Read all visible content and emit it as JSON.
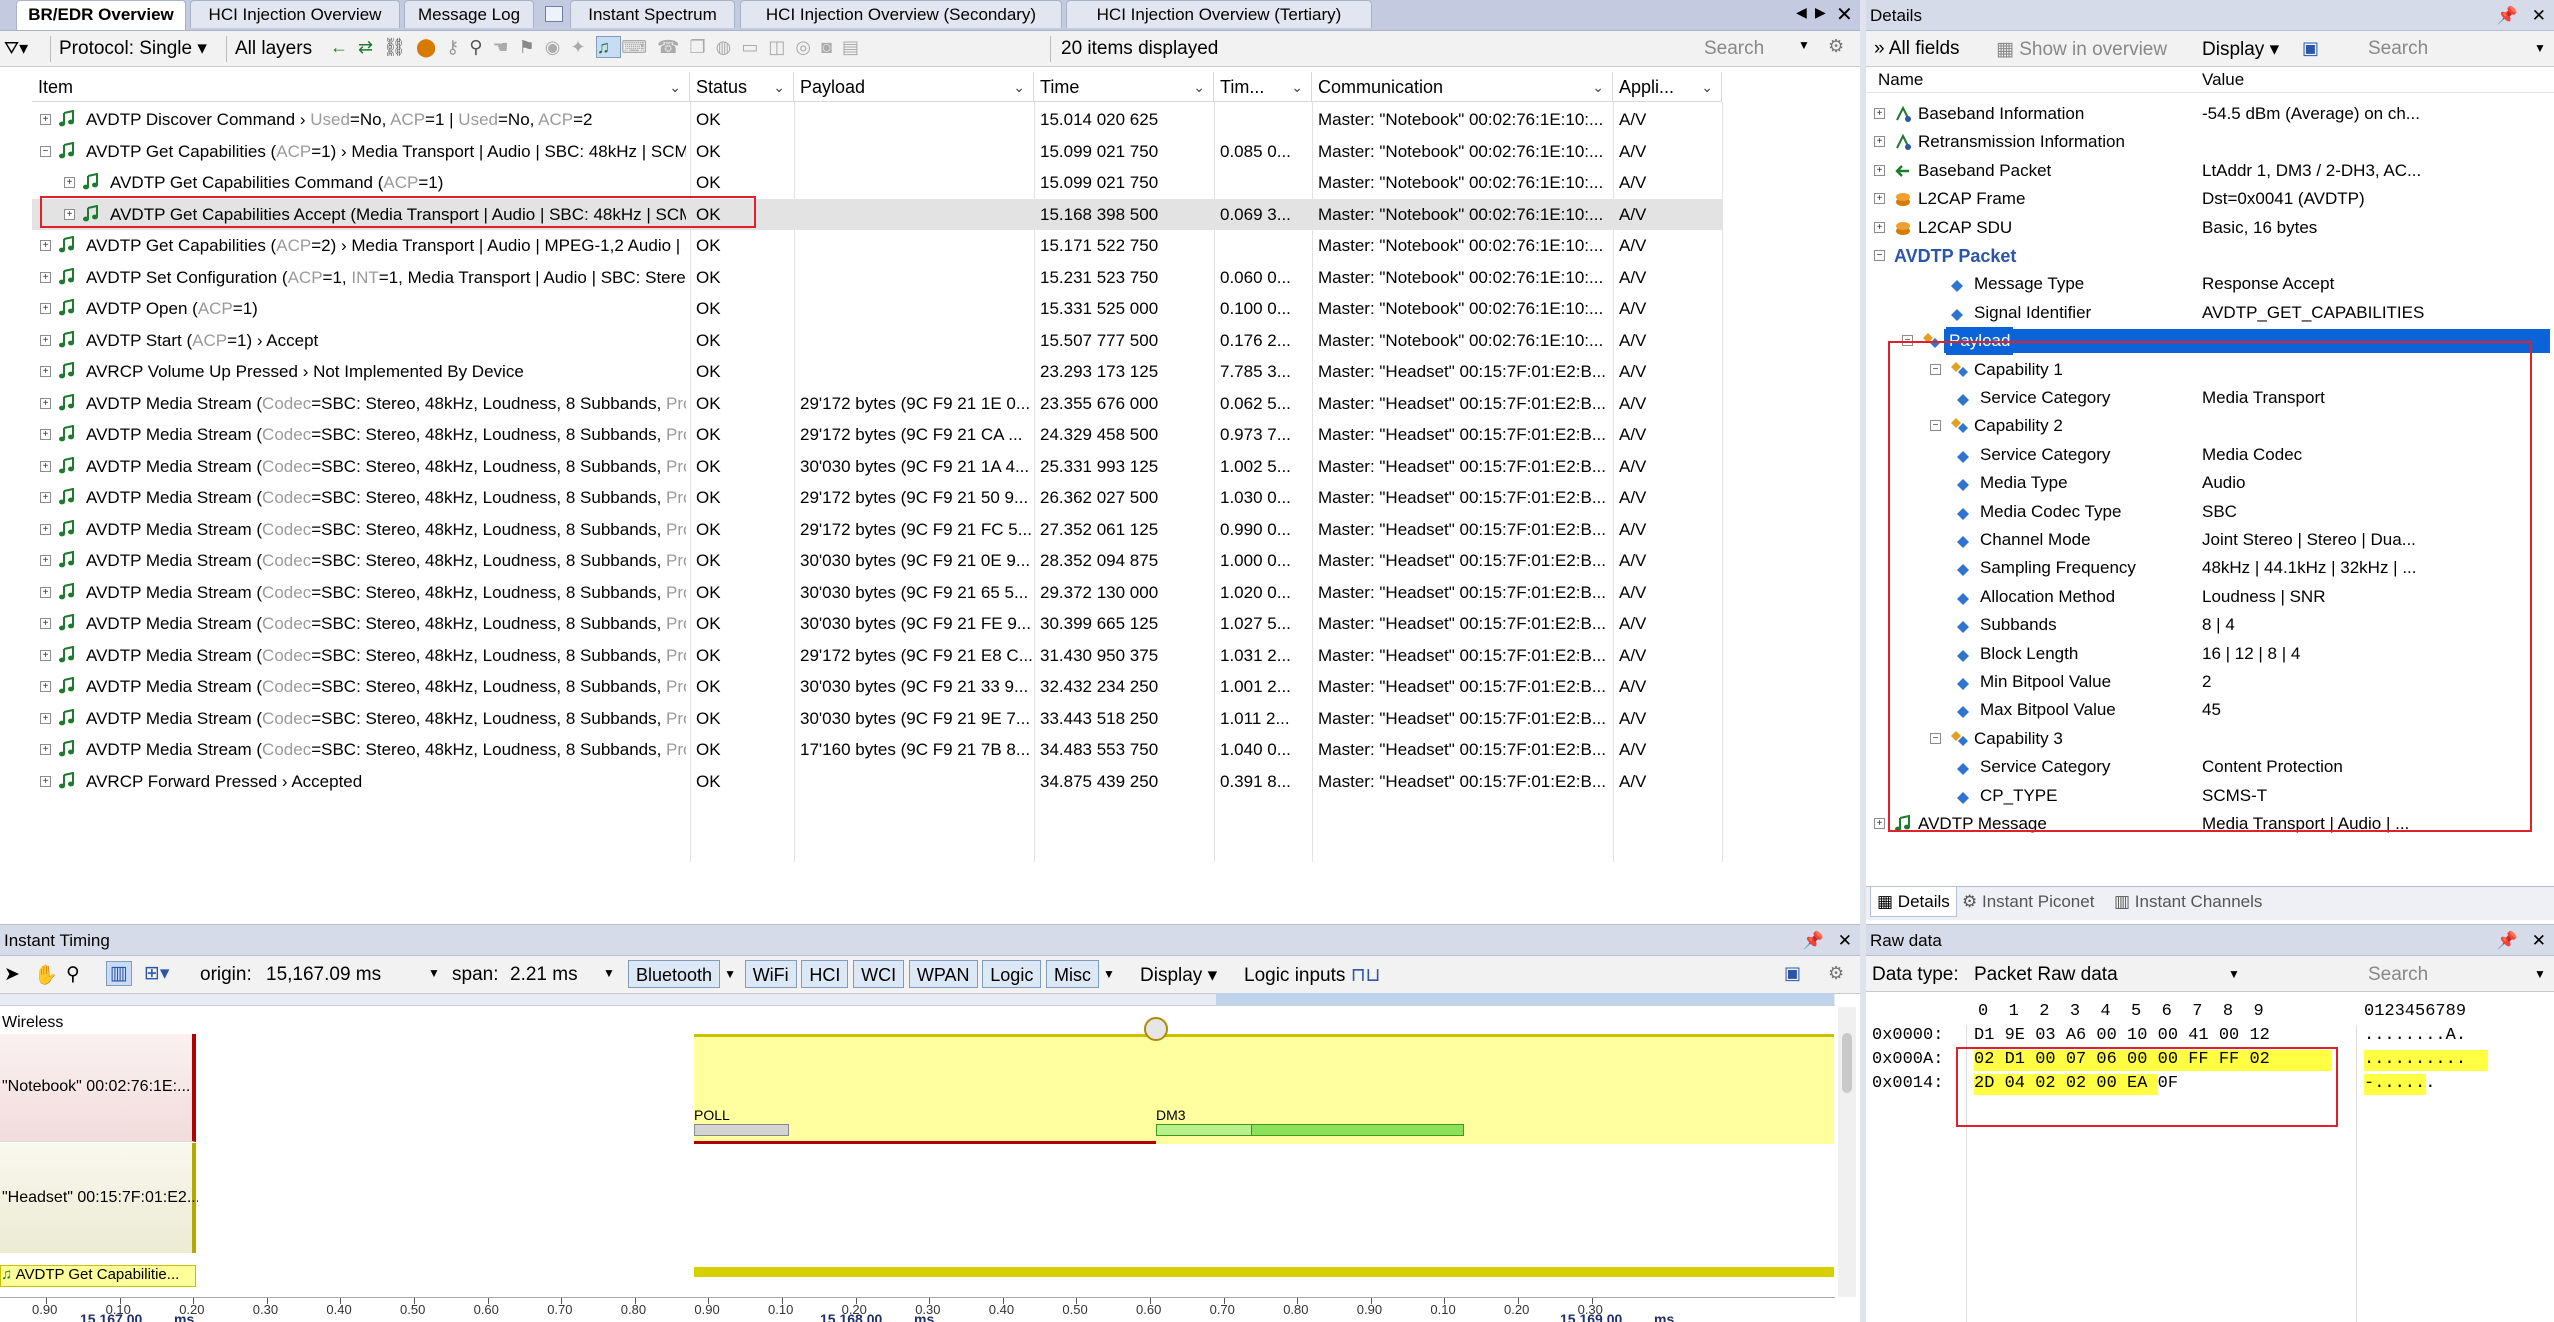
{
  "tabs": [
    {
      "label": "BR/EDR Overview",
      "active": true
    },
    {
      "label": "HCI Injection Overview",
      "active": false
    },
    {
      "label": "Message Log",
      "active": false
    },
    {
      "label": "Instant Spectrum",
      "active": false
    },
    {
      "label": "HCI Injection Overview (Secondary)",
      "active": false
    },
    {
      "label": "HCI Injection Overview (Tertiary)",
      "active": false
    }
  ],
  "toolbar": {
    "protocol": "Protocol: Single",
    "layers": "All layers",
    "count": "20 items displayed",
    "search_placeholder": "Search"
  },
  "columns": [
    "Item",
    "Status",
    "Payload",
    "Time",
    "Tim...",
    "Communication",
    "Appli..."
  ],
  "rows": [
    {
      "indent": 0,
      "exp": "+",
      "item": [
        [
          "AVDTP Discover Command › ",
          ""
        ],
        [
          "Used",
          "g"
        ],
        [
          "=No, ",
          ""
        ],
        [
          "ACP",
          "g"
        ],
        [
          "=1 | ",
          ""
        ],
        [
          "Used",
          "g"
        ],
        [
          "=No, ",
          ""
        ],
        [
          "ACP",
          "g"
        ],
        [
          "=2",
          ""
        ]
      ],
      "status": "OK",
      "payload": "",
      "time": "15.014 020 625",
      "tim": "",
      "comm": "Master: \"Notebook\" 00:02:76:1E:10:...",
      "app": "A/V"
    },
    {
      "indent": 0,
      "exp": "−",
      "item": [
        [
          "AVDTP Get Capabilities (",
          ""
        ],
        [
          "ACP",
          "g"
        ],
        [
          "=1) › Media Transport | Audio | SBC: 48kHz | SCMS-T",
          ""
        ]
      ],
      "status": "OK",
      "payload": "",
      "time": "15.099 021 750",
      "tim": "0.085 0...",
      "comm": "Master: \"Notebook\" 00:02:76:1E:10:...",
      "app": "A/V"
    },
    {
      "indent": 1,
      "exp": "+",
      "item": [
        [
          "AVDTP Get Capabilities Command (",
          ""
        ],
        [
          "ACP",
          "g"
        ],
        [
          "=1)",
          ""
        ]
      ],
      "status": "OK",
      "payload": "",
      "time": "15.099 021 750",
      "tim": "",
      "comm": "Master: \"Notebook\" 00:02:76:1E:10:...",
      "app": "A/V"
    },
    {
      "indent": 1,
      "exp": "+",
      "item": [
        [
          "AVDTP Get Capabilities Accept (Media Transport | Audio | SBC: 48kHz | SCM...",
          ""
        ]
      ],
      "status": "OK",
      "payload": "",
      "time": "15.168 398 500",
      "tim": "0.069 3...",
      "comm": "Master: \"Notebook\" 00:02:76:1E:10:...",
      "app": "A/V",
      "selected": true
    },
    {
      "indent": 0,
      "exp": "+",
      "item": [
        [
          "AVDTP Get Capabilities (",
          ""
        ],
        [
          "ACP",
          "g"
        ],
        [
          "=2) › Media Transport | Audio | MPEG-1,2 Audio | S...",
          ""
        ]
      ],
      "status": "OK",
      "payload": "",
      "time": "15.171 522 750",
      "tim": "",
      "comm": "Master: \"Notebook\" 00:02:76:1E:10:...",
      "app": "A/V"
    },
    {
      "indent": 0,
      "exp": "+",
      "item": [
        [
          "AVDTP Set Configuration (",
          ""
        ],
        [
          "ACP",
          "g"
        ],
        [
          "=1, ",
          ""
        ],
        [
          "INT",
          "g"
        ],
        [
          "=1, Media Transport | Audio | SBC: Stere...",
          ""
        ]
      ],
      "status": "OK",
      "payload": "",
      "time": "15.231 523 750",
      "tim": "0.060 0...",
      "comm": "Master: \"Notebook\" 00:02:76:1E:10:...",
      "app": "A/V"
    },
    {
      "indent": 0,
      "exp": "+",
      "item": [
        [
          "AVDTP Open (",
          ""
        ],
        [
          "ACP",
          "g"
        ],
        [
          "=1)",
          ""
        ]
      ],
      "status": "OK",
      "payload": "",
      "time": "15.331 525 000",
      "tim": "0.100 0...",
      "comm": "Master: \"Notebook\" 00:02:76:1E:10:...",
      "app": "A/V"
    },
    {
      "indent": 0,
      "exp": "+",
      "item": [
        [
          "AVDTP Start (",
          ""
        ],
        [
          "ACP",
          "g"
        ],
        [
          "=1) › Accept",
          ""
        ]
      ],
      "status": "OK",
      "payload": "",
      "time": "15.507 777 500",
      "tim": "0.176 2...",
      "comm": "Master: \"Notebook\" 00:02:76:1E:10:...",
      "app": "A/V"
    },
    {
      "indent": 0,
      "exp": "+",
      "item": [
        [
          "AVRCP Volume Up Pressed › Not Implemented By Device",
          ""
        ]
      ],
      "status": "OK",
      "payload": "",
      "time": "23.293 173 125",
      "tim": "7.785 3...",
      "comm": "Master: \"Headset\" 00:15:7F:01:E2:B...",
      "app": "A/V"
    },
    {
      "indent": 0,
      "exp": "+",
      "item": [
        [
          "AVDTP Media Stream (",
          ""
        ],
        [
          "Codec",
          "g"
        ],
        [
          "=SBC: Stereo, 48kHz, Loudness, 8 Subbands, ",
          ""
        ],
        [
          "Prot...",
          "g"
        ]
      ],
      "status": "OK",
      "payload": "29'172 bytes (9C F9 21 1E 0...",
      "time": "23.355 676 000",
      "tim": "0.062 5...",
      "comm": "Master: \"Headset\" 00:15:7F:01:E2:B...",
      "app": "A/V"
    },
    {
      "indent": 0,
      "exp": "+",
      "item": [
        [
          "AVDTP Media Stream (",
          ""
        ],
        [
          "Codec",
          "g"
        ],
        [
          "=SBC: Stereo, 48kHz, Loudness, 8 Subbands, ",
          ""
        ],
        [
          "Prot...",
          "g"
        ]
      ],
      "status": "OK",
      "payload": "29'172 bytes (9C F9 21 CA ...",
      "time": "24.329 458 500",
      "tim": "0.973 7...",
      "comm": "Master: \"Headset\" 00:15:7F:01:E2:B...",
      "app": "A/V"
    },
    {
      "indent": 0,
      "exp": "+",
      "item": [
        [
          "AVDTP Media Stream (",
          ""
        ],
        [
          "Codec",
          "g"
        ],
        [
          "=SBC: Stereo, 48kHz, Loudness, 8 Subbands, ",
          ""
        ],
        [
          "Prot...",
          "g"
        ]
      ],
      "status": "OK",
      "payload": "30'030 bytes (9C F9 21 1A 4...",
      "time": "25.331 993 125",
      "tim": "1.002 5...",
      "comm": "Master: \"Headset\" 00:15:7F:01:E2:B...",
      "app": "A/V"
    },
    {
      "indent": 0,
      "exp": "+",
      "item": [
        [
          "AVDTP Media Stream (",
          ""
        ],
        [
          "Codec",
          "g"
        ],
        [
          "=SBC: Stereo, 48kHz, Loudness, 8 Subbands, ",
          ""
        ],
        [
          "Prot...",
          "g"
        ]
      ],
      "status": "OK",
      "payload": "29'172 bytes (9C F9 21 50 9...",
      "time": "26.362 027 500",
      "tim": "1.030 0...",
      "comm": "Master: \"Headset\" 00:15:7F:01:E2:B...",
      "app": "A/V"
    },
    {
      "indent": 0,
      "exp": "+",
      "item": [
        [
          "AVDTP Media Stream (",
          ""
        ],
        [
          "Codec",
          "g"
        ],
        [
          "=SBC: Stereo, 48kHz, Loudness, 8 Subbands, ",
          ""
        ],
        [
          "Prot...",
          "g"
        ]
      ],
      "status": "OK",
      "payload": "29'172 bytes (9C F9 21 FC 5...",
      "time": "27.352 061 125",
      "tim": "0.990 0...",
      "comm": "Master: \"Headset\" 00:15:7F:01:E2:B...",
      "app": "A/V"
    },
    {
      "indent": 0,
      "exp": "+",
      "item": [
        [
          "AVDTP Media Stream (",
          ""
        ],
        [
          "Codec",
          "g"
        ],
        [
          "=SBC: Stereo, 48kHz, Loudness, 8 Subbands, ",
          ""
        ],
        [
          "Prot...",
          "g"
        ]
      ],
      "status": "OK",
      "payload": "30'030 bytes (9C F9 21 0E 9...",
      "time": "28.352 094 875",
      "tim": "1.000 0...",
      "comm": "Master: \"Headset\" 00:15:7F:01:E2:B...",
      "app": "A/V"
    },
    {
      "indent": 0,
      "exp": "+",
      "item": [
        [
          "AVDTP Media Stream (",
          ""
        ],
        [
          "Codec",
          "g"
        ],
        [
          "=SBC: Stereo, 48kHz, Loudness, 8 Subbands, ",
          ""
        ],
        [
          "Prot...",
          "g"
        ]
      ],
      "status": "OK",
      "payload": "30'030 bytes (9C F9 21 65 5...",
      "time": "29.372 130 000",
      "tim": "1.020 0...",
      "comm": "Master: \"Headset\" 00:15:7F:01:E2:B...",
      "app": "A/V"
    },
    {
      "indent": 0,
      "exp": "+",
      "item": [
        [
          "AVDTP Media Stream (",
          ""
        ],
        [
          "Codec",
          "g"
        ],
        [
          "=SBC: Stereo, 48kHz, Loudness, 8 Subbands, ",
          ""
        ],
        [
          "Prot...",
          "g"
        ]
      ],
      "status": "OK",
      "payload": "30'030 bytes (9C F9 21 FE 9...",
      "time": "30.399 665 125",
      "tim": "1.027 5...",
      "comm": "Master: \"Headset\" 00:15:7F:01:E2:B...",
      "app": "A/V"
    },
    {
      "indent": 0,
      "exp": "+",
      "item": [
        [
          "AVDTP Media Stream (",
          ""
        ],
        [
          "Codec",
          "g"
        ],
        [
          "=SBC: Stereo, 48kHz, Loudness, 8 Subbands, ",
          ""
        ],
        [
          "Prot...",
          "g"
        ]
      ],
      "status": "OK",
      "payload": "29'172 bytes (9C F9 21 E8 C...",
      "time": "31.430 950 375",
      "tim": "1.031 2...",
      "comm": "Master: \"Headset\" 00:15:7F:01:E2:B...",
      "app": "A/V"
    },
    {
      "indent": 0,
      "exp": "+",
      "item": [
        [
          "AVDTP Media Stream (",
          ""
        ],
        [
          "Codec",
          "g"
        ],
        [
          "=SBC: Stereo, 48kHz, Loudness, 8 Subbands, ",
          ""
        ],
        [
          "Prot...",
          "g"
        ]
      ],
      "status": "OK",
      "payload": "30'030 bytes (9C F9 21 33 9...",
      "time": "32.432 234 250",
      "tim": "1.001 2...",
      "comm": "Master: \"Headset\" 00:15:7F:01:E2:B...",
      "app": "A/V"
    },
    {
      "indent": 0,
      "exp": "+",
      "item": [
        [
          "AVDTP Media Stream (",
          ""
        ],
        [
          "Codec",
          "g"
        ],
        [
          "=SBC: Stereo, 48kHz, Loudness, 8 Subbands, ",
          ""
        ],
        [
          "Prot...",
          "g"
        ]
      ],
      "status": "OK",
      "payload": "30'030 bytes (9C F9 21 9E 7...",
      "time": "33.443 518 250",
      "tim": "1.011 2...",
      "comm": "Master: \"Headset\" 00:15:7F:01:E2:B...",
      "app": "A/V"
    },
    {
      "indent": 0,
      "exp": "+",
      "item": [
        [
          "AVDTP Media Stream (",
          ""
        ],
        [
          "Codec",
          "g"
        ],
        [
          "=SBC: Stereo, 48kHz, Loudness, 8 Subbands, ",
          ""
        ],
        [
          "Prot...",
          "g"
        ]
      ],
      "status": "OK",
      "payload": "17'160 bytes (9C F9 21 7B 8...",
      "time": "34.483 553 750",
      "tim": "1.040 0...",
      "comm": "Master: \"Headset\" 00:15:7F:01:E2:B...",
      "app": "A/V"
    },
    {
      "indent": 0,
      "exp": "+",
      "item": [
        [
          "AVRCP Forward Pressed › Accepted",
          ""
        ]
      ],
      "status": "OK",
      "payload": "",
      "time": "34.875 439 250",
      "tim": "0.391 8...",
      "comm": "Master: \"Headset\" 00:15:7F:01:E2:B...",
      "app": "A/V"
    }
  ],
  "details": {
    "title": "Details",
    "all_fields": "All fields",
    "show_overview": "Show in overview",
    "display": "Display",
    "search_placeholder": "Search",
    "col_name": "Name",
    "col_value": "Value",
    "rows": [
      {
        "lvl": 0,
        "exp": "+",
        "icon": "sig",
        "name": "Baseband Information",
        "value": "-54.5 dBm (Average) on ch...",
        "sel": false,
        "bold": false
      },
      {
        "lvl": 0,
        "exp": "+",
        "icon": "sig",
        "name": "Retransmission Information",
        "value": "",
        "sel": false,
        "bold": false
      },
      {
        "lvl": 0,
        "exp": "+",
        "icon": "arrow",
        "name": "Baseband Packet",
        "value": "LtAddr 1, DM3 / 2-DH3, AC...",
        "sel": false,
        "bold": false
      },
      {
        "lvl": 0,
        "exp": "+",
        "icon": "layers",
        "name": "L2CAP Frame",
        "value": "Dst=0x0041 (AVDTP)",
        "sel": false,
        "bold": false
      },
      {
        "lvl": 0,
        "exp": "+",
        "icon": "layers",
        "name": "L2CAP SDU",
        "value": "Basic, 16 bytes",
        "sel": false,
        "bold": false
      },
      {
        "lvl": 0,
        "exp": "−",
        "icon": "",
        "name": "AVDTP Packet",
        "value": "",
        "sel": false,
        "bold": true
      },
      {
        "lvl": 2,
        "exp": "",
        "icon": "diamond",
        "name": "Message Type",
        "value": "Response Accept",
        "sel": false,
        "bold": false
      },
      {
        "lvl": 2,
        "exp": "",
        "icon": "diamond",
        "name": "Signal Identifier",
        "value": "AVDTP_GET_CAPABILITIES",
        "sel": false,
        "bold": false
      },
      {
        "lvl": 1,
        "exp": "−",
        "icon": "group",
        "name": "Payload",
        "value": "",
        "sel": true,
        "bold": false
      },
      {
        "lvl": 2,
        "exp": "−",
        "icon": "group",
        "name": "Capability 1",
        "value": "",
        "sel": false,
        "bold": false
      },
      {
        "lvl": 3,
        "exp": "",
        "icon": "diamond",
        "name": "Service Category",
        "value": "Media Transport",
        "sel": false,
        "bold": false
      },
      {
        "lvl": 2,
        "exp": "−",
        "icon": "group",
        "name": "Capability 2",
        "value": "",
        "sel": false,
        "bold": false
      },
      {
        "lvl": 3,
        "exp": "",
        "icon": "diamond",
        "name": "Service Category",
        "value": "Media Codec",
        "sel": false,
        "bold": false
      },
      {
        "lvl": 3,
        "exp": "",
        "icon": "diamond",
        "name": "Media Type",
        "value": "Audio",
        "sel": false,
        "bold": false
      },
      {
        "lvl": 3,
        "exp": "",
        "icon": "diamond",
        "name": "Media Codec Type",
        "value": "SBC",
        "sel": false,
        "bold": false
      },
      {
        "lvl": 3,
        "exp": "",
        "icon": "diamond",
        "name": "Channel Mode",
        "value": "Joint Stereo | Stereo | Dua...",
        "sel": false,
        "bold": false
      },
      {
        "lvl": 3,
        "exp": "",
        "icon": "diamond",
        "name": "Sampling Frequency",
        "value": "48kHz | 44.1kHz | 32kHz | ...",
        "sel": false,
        "bold": false
      },
      {
        "lvl": 3,
        "exp": "",
        "icon": "diamond",
        "name": "Allocation Method",
        "value": "Loudness | SNR",
        "sel": false,
        "bold": false
      },
      {
        "lvl": 3,
        "exp": "",
        "icon": "diamond",
        "name": "Subbands",
        "value": "8 | 4",
        "sel": false,
        "bold": false
      },
      {
        "lvl": 3,
        "exp": "",
        "icon": "diamond",
        "name": "Block Length",
        "value": "16 | 12 | 8 | 4",
        "sel": false,
        "bold": false
      },
      {
        "lvl": 3,
        "exp": "",
        "icon": "diamond",
        "name": "Min Bitpool Value",
        "value": "2",
        "sel": false,
        "bold": false
      },
      {
        "lvl": 3,
        "exp": "",
        "icon": "diamond",
        "name": "Max Bitpool Value",
        "value": "45",
        "sel": false,
        "bold": false
      },
      {
        "lvl": 2,
        "exp": "−",
        "icon": "group",
        "name": "Capability 3",
        "value": "",
        "sel": false,
        "bold": false
      },
      {
        "lvl": 3,
        "exp": "",
        "icon": "diamond",
        "name": "Service Category",
        "value": "Content Protection",
        "sel": false,
        "bold": false
      },
      {
        "lvl": 3,
        "exp": "",
        "icon": "diamond",
        "name": "CP_TYPE",
        "value": "SCMS-T",
        "sel": false,
        "bold": false
      },
      {
        "lvl": 0,
        "exp": "+",
        "icon": "note",
        "name": "AVDTP Message",
        "value": "Media Transport | Audio | ...",
        "sel": false,
        "bold": false
      }
    ],
    "bottom_tabs": [
      "Details",
      "Instant Piconet",
      "Instant Channels"
    ]
  },
  "timing": {
    "title": "Instant Timing",
    "origin_label": "origin:",
    "origin_value": "15,167.09 ms",
    "span_label": "span:",
    "span_value": "2.21 ms",
    "filters": [
      "Bluetooth",
      "WiFi",
      "HCI",
      "WCI",
      "WPAN",
      "Logic",
      "Misc"
    ],
    "display": "Display",
    "logic_inputs": "Logic inputs",
    "wireless": "Wireless",
    "device1": "\"Notebook\" 00:02:76:1E:...",
    "device2": "\"Headset\" 00:15:7F:01:E2...",
    "packet_label": "AVDTP Get Capabilitie...",
    "poll": "POLL",
    "dm3": "DM3",
    "ticks_small": [
      "0.90",
      "0.10",
      "0.20",
      "0.30",
      "0.40",
      "0.50",
      "0.60",
      "0.70",
      "0.80",
      "0.90",
      "0.10",
      "0.20",
      "0.30",
      "0.40",
      "0.50",
      "0.60",
      "0.70",
      "0.80",
      "0.90",
      "0.10",
      "0.20",
      "0.30"
    ],
    "ticks_major": [
      "15,167.00",
      "ms",
      "15,168.00",
      "ms",
      "15,169.00",
      "ms"
    ]
  },
  "raw": {
    "title": "Raw data",
    "data_type_label": "Data type:",
    "data_type": "Packet Raw data",
    "search_placeholder": "Search",
    "col_header": "0  1  2  3  4  5  6  7  8  9",
    "ascii_header": "0123456789",
    "lines": [
      {
        "addr": "0x0000:",
        "hex": "D1 9E 03 A6 00 10 00 41 00 12",
        "ascii": "........A."
      },
      {
        "addr": "0x000A:",
        "hex": "02 D1 00 07 06 00 00 FF FF 02",
        "ascii": ".........."
      },
      {
        "addr": "0x0014:",
        "hex": "2D 04 02 02 00 EA 0F",
        "ascii": "-......"
      }
    ]
  },
  "colors": {
    "accent": "#0a64d8",
    "highlight_box": "#e0202a",
    "yellow": "#ffffa0",
    "title_blue": "#d6dbe9"
  }
}
